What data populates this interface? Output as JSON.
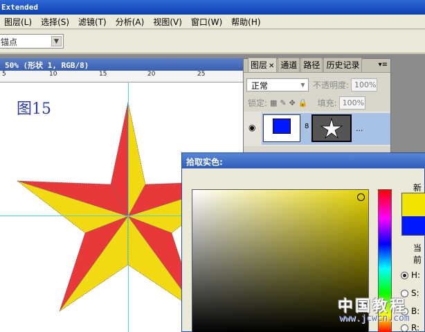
{
  "app": {
    "title": "Extended"
  },
  "menu": [
    {
      "label": "图层(L)"
    },
    {
      "label": "选择(S)"
    },
    {
      "label": "滤镜(T)"
    },
    {
      "label": "分析(A)"
    },
    {
      "label": "视图(V)"
    },
    {
      "label": "窗口(W)"
    },
    {
      "label": "帮助(H)"
    }
  ],
  "options": {
    "select_value": "锚点"
  },
  "document": {
    "title": "50% (形状 1, RGB/8)",
    "ruler_ticks": [
      "5",
      "10",
      "15",
      "20",
      "25"
    ],
    "figure_label": "图15",
    "star_colors": {
      "red": "#e8383a",
      "yellow": "#f1da12"
    }
  },
  "layers_panel": {
    "tabs": [
      "图层",
      "通道",
      "路径",
      "历史记录"
    ],
    "blend_mode": "正常",
    "opacity_label": "不透明度:",
    "opacity_value": "100%",
    "lock_label": "锁定:",
    "fill_label": "填充:",
    "fill_value": "100%",
    "layer_dots": "..."
  },
  "color_picker": {
    "title": "拾取实色:",
    "new_label": "新的",
    "current_label": "当前",
    "new_color": "#f1e400",
    "current_color": "#0018ff",
    "modes": [
      {
        "label": "H:",
        "checked": true
      },
      {
        "label": "S:",
        "checked": false
      },
      {
        "label": "B:",
        "checked": false
      },
      {
        "label": "R:",
        "checked": false
      }
    ]
  },
  "watermark": {
    "text": "中国教程",
    "url": "www.jcwcn.com"
  }
}
